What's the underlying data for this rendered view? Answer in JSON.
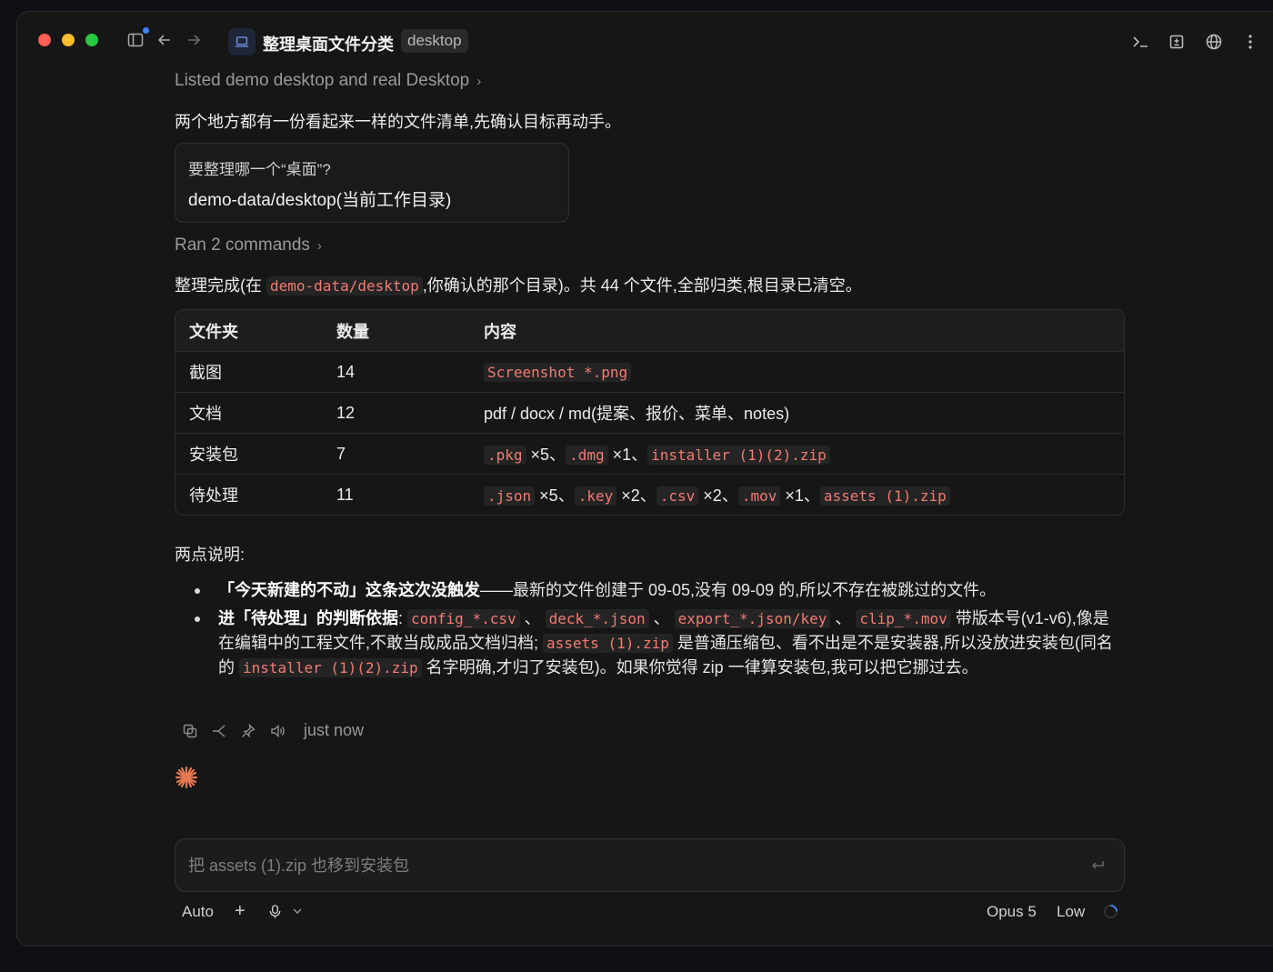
{
  "titlebar": {
    "title": "整理桌面文件分类",
    "badge": "desktop"
  },
  "messages": {
    "listed_summary": "Listed demo desktop and real Desktop",
    "intro": "两个地方都有一份看起来一样的文件清单,先确认目标再动手。",
    "question": {
      "prompt": "要整理哪一个“桌面”?",
      "answer": "demo-data/desktop(当前工作目录)"
    },
    "ran_summary": "Ran 2 commands",
    "result_prefix": "整理完成(在 ",
    "result_code": "demo-data/desktop",
    "result_suffix": ",你确认的那个目录)。共 44 个文件,全部归类,根目录已清空。"
  },
  "table": {
    "headers": [
      "文件夹",
      "数量",
      "内容"
    ],
    "rows": [
      {
        "folder": "截图",
        "count": "14"
      },
      {
        "folder": "文档",
        "count": "12",
        "content": "pdf / docx / md(提案、报价、菜单、notes)"
      },
      {
        "folder": "安装包",
        "count": "7"
      },
      {
        "folder": "待处理",
        "count": "11"
      }
    ],
    "row1_code": "Screenshot *.png",
    "row3": {
      "c1": ".pkg",
      "t1": " ×5、",
      "c2": ".dmg",
      "t2": " ×1、",
      "c3": "installer (1)(2).zip"
    },
    "row4": {
      "c1": ".json",
      "t1": " ×5、",
      "c2": ".key",
      "t2": " ×2、",
      "c3": ".csv",
      "t3": " ×2、",
      "c4": ".mov",
      "t4": " ×1、",
      "c5": "assets (1).zip"
    }
  },
  "notes": {
    "title": "两点说明:",
    "b1_bold": "「今天新建的不动」这条这次没触发",
    "b1_text": "——最新的文件创建于 09-05,没有 09-09 的,所以不存在被跳过的文件。",
    "b2_bold": "进「待处理」的判断依据",
    "b2_t0": ": ",
    "b2_c1": "config_*.csv",
    "b2_t1": " 、 ",
    "b2_c2": "deck_*.json",
    "b2_t2": " 、 ",
    "b2_c3": "export_*.json/key",
    "b2_t3": " 、 ",
    "b2_c4": "clip_*.mov",
    "b2_t4": " 带版本号(v1-v6),像是在编辑中的工程文件,不敢当成成品文档归档; ",
    "b2_c5": "assets (1).zip",
    "b2_t5": " 是普通压缩包、看不出是不是安装器,所以没放进安装包(同名的 ",
    "b2_c6": "installer (1)(2).zip",
    "b2_t6": " 名字明确,才归了安装包)。如果你觉得 zip 一律算安装包,我可以把它挪过去。"
  },
  "actions": {
    "timestamp": "just now"
  },
  "composer": {
    "placeholder": "把 assets (1).zip 也移到安装包",
    "mode": "Auto",
    "model": "Opus 5",
    "effort": "Low"
  },
  "colors": {
    "accent": "#3b82f6",
    "code": "#f27b72",
    "spark": "#e8784f"
  }
}
